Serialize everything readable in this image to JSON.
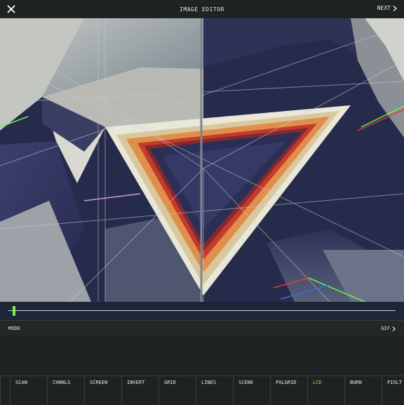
{
  "header": {
    "title": "IMAGE EDITOR",
    "next_label": "NEXT"
  },
  "scrubber": {
    "position": 0.01
  },
  "mode": {
    "label": "MODE",
    "value": "GIF"
  },
  "effects": {
    "items": [
      "SCAN",
      "CHNNLS",
      "SCREEN",
      "INVERT",
      "GRID",
      "LINES",
      "SCENE",
      "PXLGRID",
      "LCD",
      "BURN",
      "PIXLT"
    ],
    "active": "LCD"
  },
  "colors": {
    "accent": "#7cf04a",
    "background": "#1f2222",
    "canvas": "#262b4b"
  },
  "icons": {
    "close": "close-icon",
    "next": "chevron-right-icon",
    "mode": "chevron-right-icon"
  }
}
